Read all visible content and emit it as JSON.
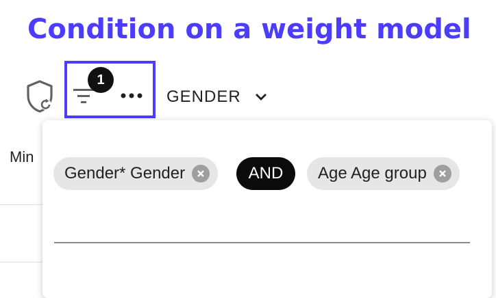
{
  "headline": "Condition on a weight model",
  "toolbar": {
    "filter_badge_count": "1",
    "select_value": "GENDER",
    "icons": [
      "shield-refresh-icon",
      "filter-icon",
      "more-icon",
      "chevron-down-icon"
    ]
  },
  "side": {
    "label": "Min"
  },
  "conditions": {
    "chips": [
      {
        "label": "Gender* Gender"
      },
      {
        "label": "Age Age group"
      }
    ],
    "operator": "AND"
  },
  "colors": {
    "accent": "#4b3cff",
    "chip_bg": "#e6e6e6",
    "operator_bg": "#0b0b0b",
    "badge_bg": "#111111"
  }
}
